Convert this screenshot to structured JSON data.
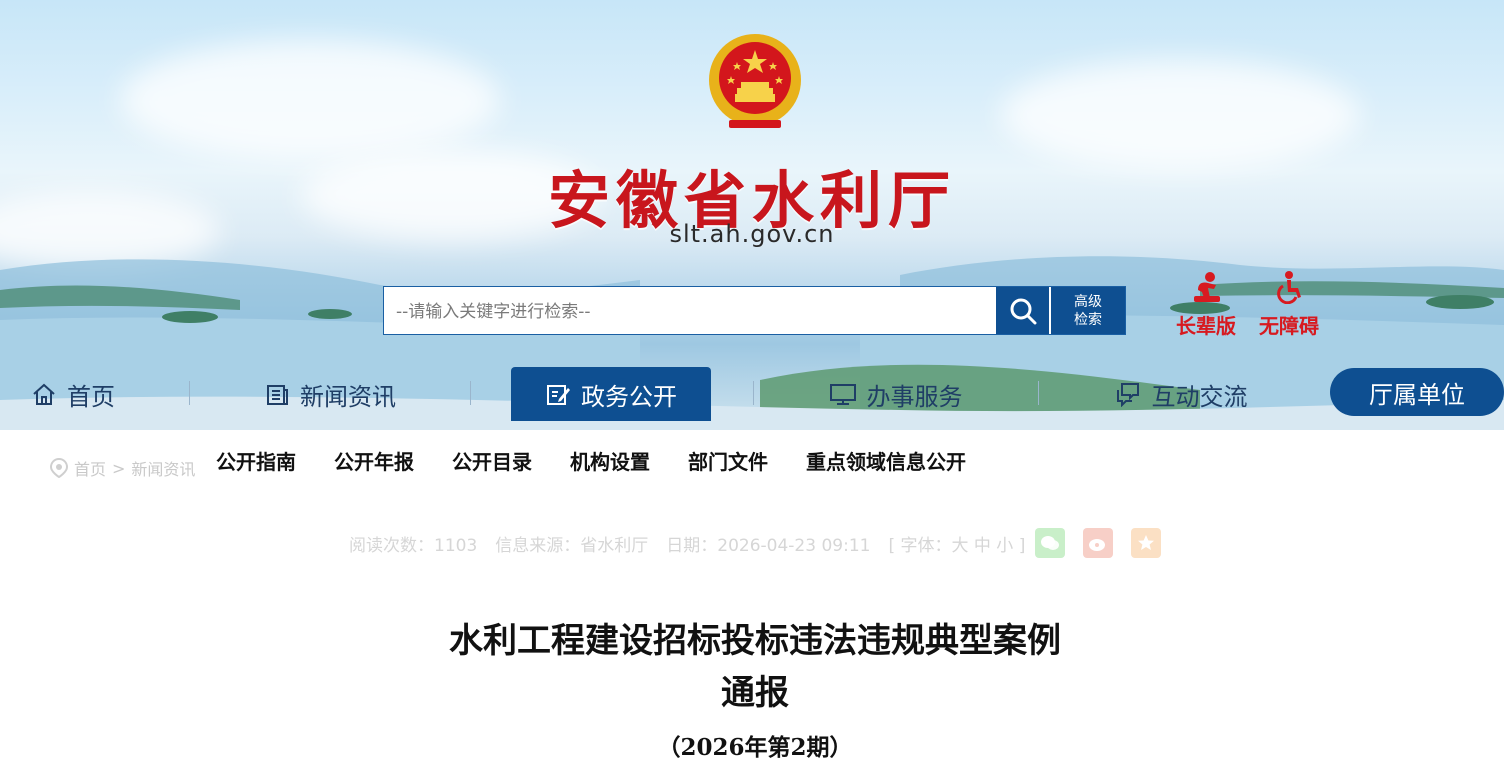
{
  "site": {
    "title": "安徽省水利厅",
    "domain": "slt.ah.gov.cn"
  },
  "search": {
    "placeholder": "--请输入关键字进行检索--",
    "advanced_line1": "高级",
    "advanced_line2": "检索"
  },
  "accessibility": {
    "elder_label": "长辈版",
    "barrier_free_label": "无障碍"
  },
  "nav": {
    "home": "首页",
    "news": "新闻资讯",
    "gov": "政务公开",
    "service": "办事服务",
    "interact": "互动交流",
    "units": "厅属单位"
  },
  "subnav": {
    "items": [
      "公开指南",
      "公开年报",
      "公开目录",
      "机构设置",
      "部门文件",
      "重点领域信息公开"
    ]
  },
  "breadcrumb": {
    "home": "首页",
    "sep": ">",
    "section": "新闻资讯"
  },
  "meta": {
    "reads": "阅读次数：1103",
    "source": "信息来源：省水利厅",
    "date": "日期：2026-04-23 09:11",
    "font_size": "[ 字体：大 中 小 ]"
  },
  "article": {
    "title_line1": "水利工程建设招标投标违法违规典型案例",
    "title_line2": "通报",
    "issue": "（2026年第2期）"
  },
  "colors": {
    "primary_blue": "#0e4f91",
    "title_red": "#c8161d",
    "access_red": "#d71a20"
  }
}
